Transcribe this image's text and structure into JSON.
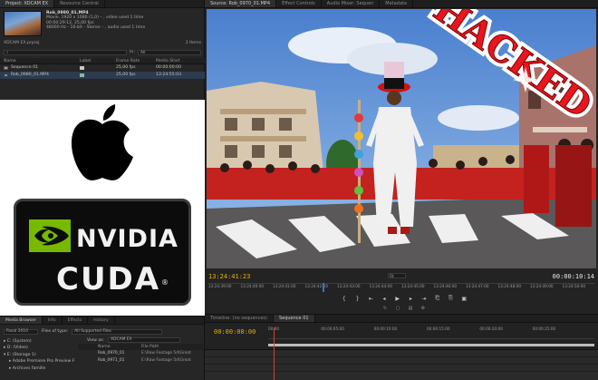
{
  "project_panel": {
    "tabs": [
      "Project: XDCAM EX",
      "Resource Central"
    ],
    "clip": {
      "name": "Rob_0980_01.MP4",
      "line1": "Movie, 1920 x 1080 (1,0) – , video used 1 time",
      "line2": "00:00:29:12, 25,00 fps",
      "line3": "48000 Hz - 16-bit - Stereo – , audio used 1 time"
    },
    "project_file": "XDCAM EX.prproj",
    "item_count": "2 Items",
    "in_label": "In:",
    "in_value": "All",
    "columns": [
      "Name",
      "Label",
      "Frame Rate",
      "Media Start"
    ],
    "rows": [
      {
        "name": "Sequence 01",
        "label_color": "#c8c8c8",
        "frame_rate": "25,00 fps",
        "media_start": "00:00:00:00"
      },
      {
        "name": "Rob_0980_01.MP4",
        "label_color": "#8fb89a",
        "frame_rate": "25,00 fps",
        "media_start": "13:24:55:03"
      }
    ]
  },
  "logos": {
    "nvidia_word": "NVIDIA",
    "cuda_word": "CUDA",
    "reg_mark": "®",
    "nvidia_green": "#76b900"
  },
  "media_browser": {
    "tabs": [
      "Media Browser",
      "Info",
      "Effects",
      "History"
    ],
    "drive_select": "Faval 2010",
    "files_of_type_label": "Files of type:",
    "files_of_type_value": "All Supported Files",
    "view_as_label": "View as:",
    "view_as_value": "XDCAM EX",
    "tree": [
      "C: (System)",
      "D: (Video)",
      "E: (Storage 1)"
    ],
    "subtree": [
      "Adobe Premiere Pro Preview F",
      "Archives famille"
    ],
    "columns": [
      "Name",
      "File Path"
    ],
    "rows": [
      {
        "name": "Rob_0970_01",
        "path": "E:\\Raw Footage 5d\\Great"
      },
      {
        "name": "Rob_0971_01",
        "path": "E:\\Raw Footage 5d\\Great"
      }
    ]
  },
  "source_monitor": {
    "tabs": [
      "Source: Rob_0970_01.MP4",
      "Effect Controls",
      "Audio Mixer: Sequen",
      "Metadata"
    ],
    "hacked_text": "HACKED",
    "timecode_in": "13:24:41:23",
    "fit_label": "Fit",
    "timecode_duration": "00:00:10:14",
    "ruler_ticks": [
      "13:24:39:00",
      "13:24:40:00",
      "13:24:41:00",
      "13:24:42:00",
      "13:24:43:00",
      "13:24:44:00",
      "13:24:45:00",
      "13:24:46:00",
      "13:24:47:00",
      "13:24:48:00",
      "13:24:49:00",
      "13:24:50:00"
    ]
  },
  "timeline": {
    "tabs": [
      "Timeline: (no sequences)",
      "Sequence 01"
    ],
    "timecode": "00:00:00:00",
    "ruler_ticks": [
      "00:00",
      "00:00:05:00",
      "00:00:10:00",
      "00:00:15:00",
      "00:00:20:00",
      "00:00:25:00"
    ]
  }
}
